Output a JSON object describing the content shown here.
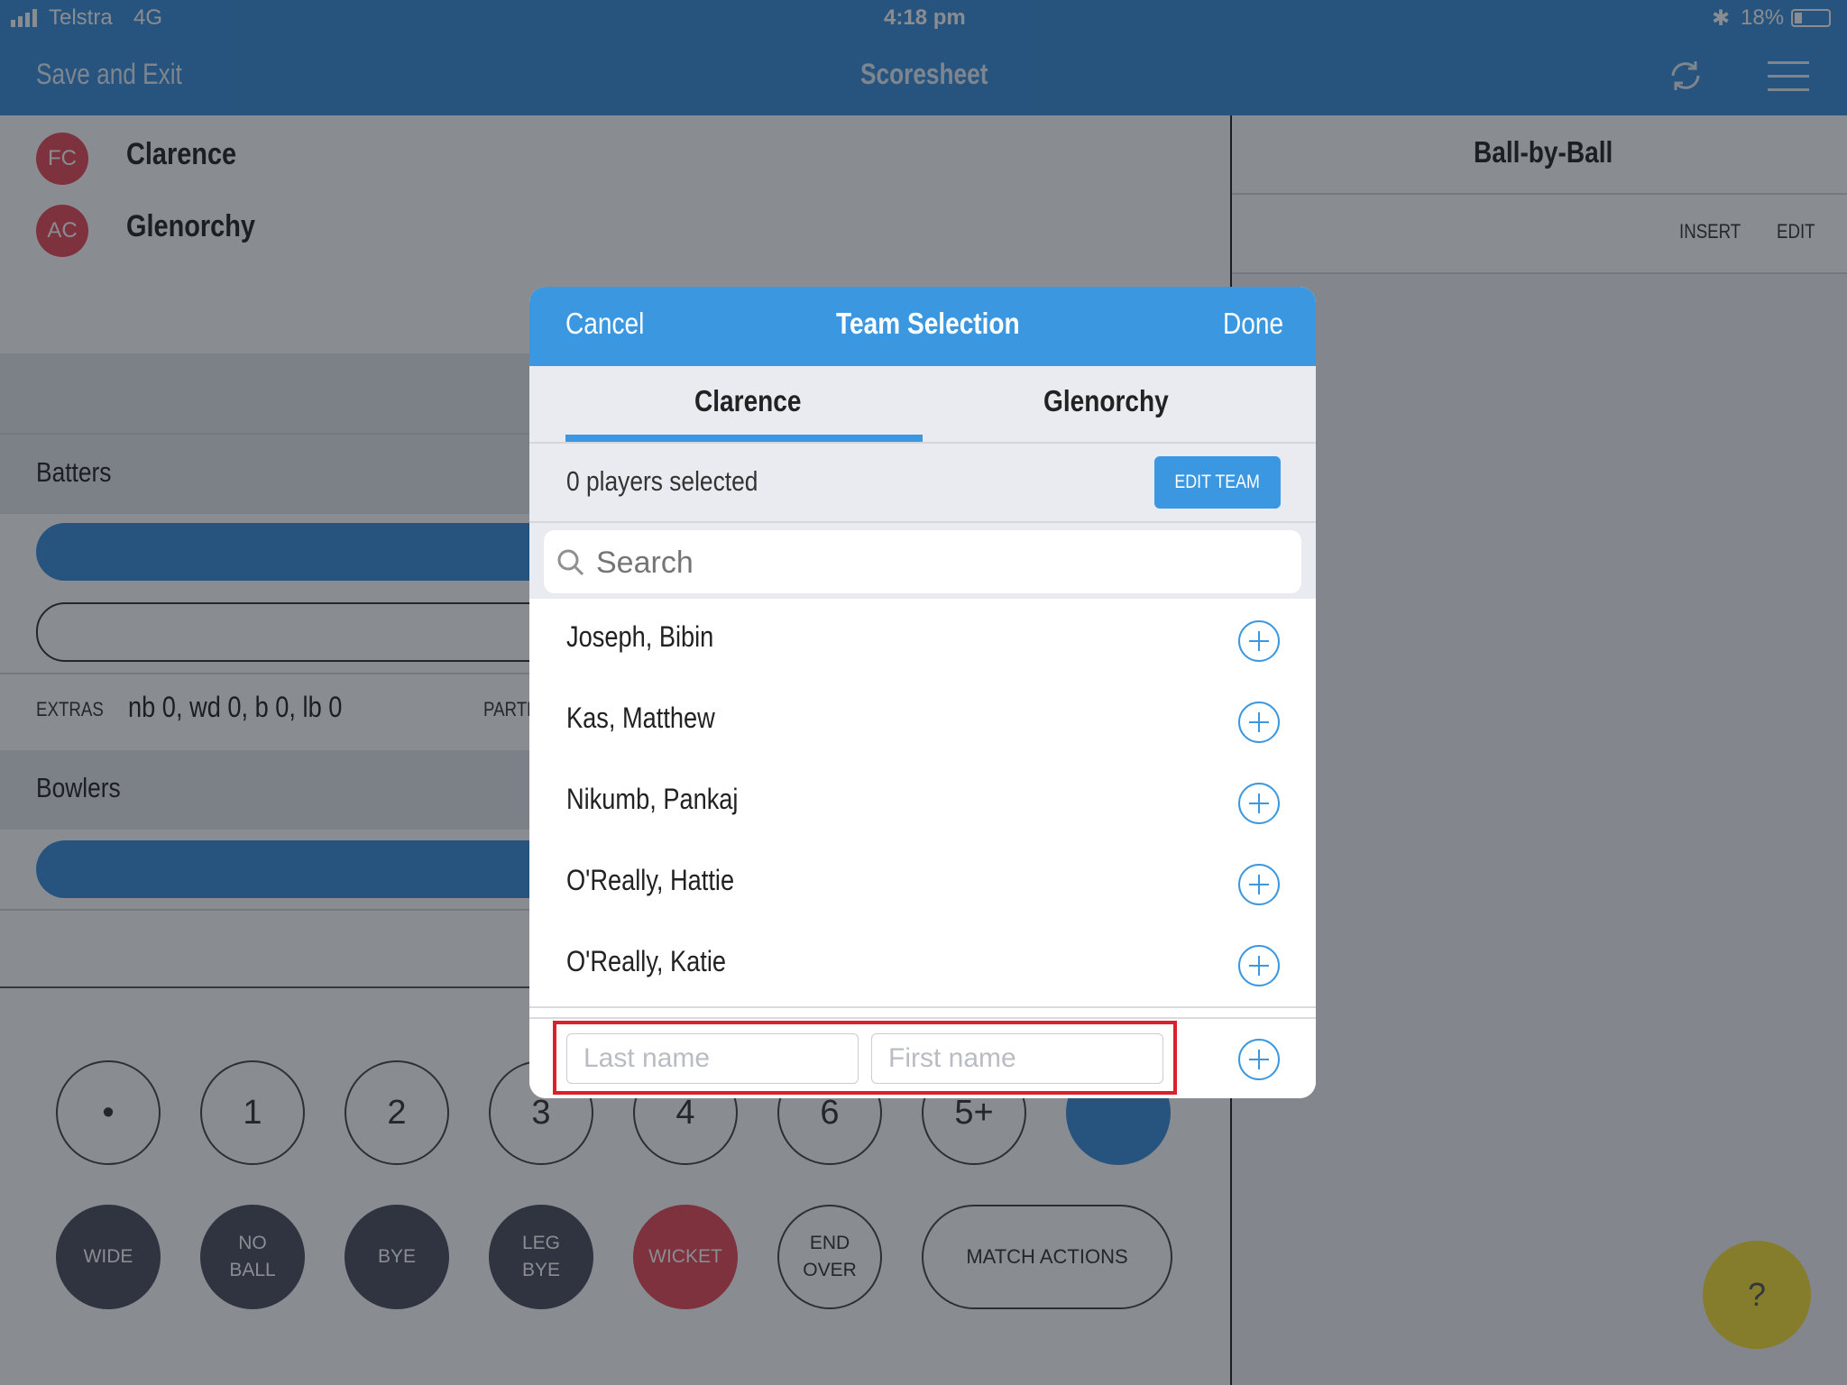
{
  "status_bar": {
    "carrier": "Telstra",
    "network": "4G",
    "time": "4:18 pm",
    "battery": "18%"
  },
  "nav": {
    "left_label": "Save and Exit",
    "title": "Scoresheet"
  },
  "teams": [
    {
      "initials": "FC",
      "name": "Clarence"
    },
    {
      "initials": "AC",
      "name": "Glenorchy"
    }
  ],
  "sections": {
    "batters": "Batters",
    "bowlers": "Bowlers"
  },
  "extras": {
    "label": "EXTRAS",
    "value": "nb 0, wd 0, b 0, lb 0",
    "partnership_label": "PARTN"
  },
  "ball_by_ball": {
    "title": "Ball-by-Ball",
    "insert": "INSERT",
    "edit": "EDIT"
  },
  "run_buttons": [
    "•",
    "1",
    "2",
    "3",
    "4",
    "6",
    "5+"
  ],
  "action_buttons": [
    {
      "line1": "WIDE",
      "line2": ""
    },
    {
      "line1": "NO",
      "line2": "BALL"
    },
    {
      "line1": "BYE",
      "line2": ""
    },
    {
      "line1": "LEG",
      "line2": "BYE"
    },
    {
      "line1": "WICKET",
      "line2": ""
    },
    {
      "line1": "END",
      "line2": "OVER"
    }
  ],
  "match_actions": "MATCH ACTIONS",
  "help": "?",
  "modal": {
    "cancel": "Cancel",
    "title": "Team Selection",
    "done": "Done",
    "tabs": [
      "Clarence",
      "Glenorchy"
    ],
    "selected_text": "0 players selected",
    "edit_team": "EDIT TEAM",
    "search_placeholder": "Search",
    "players": [
      "Joseph, Bibin",
      "Kas, Matthew",
      "Nikumb, Pankaj",
      "O'Really, Hattie",
      "O'Really, Katie"
    ],
    "last_name_placeholder": "Last name",
    "first_name_placeholder": "First name"
  },
  "colors": {
    "brand_blue": "#3b8fd8",
    "accent_red": "#e64a57",
    "help_yellow": "#f7e033",
    "highlight_red": "#d9202b"
  }
}
